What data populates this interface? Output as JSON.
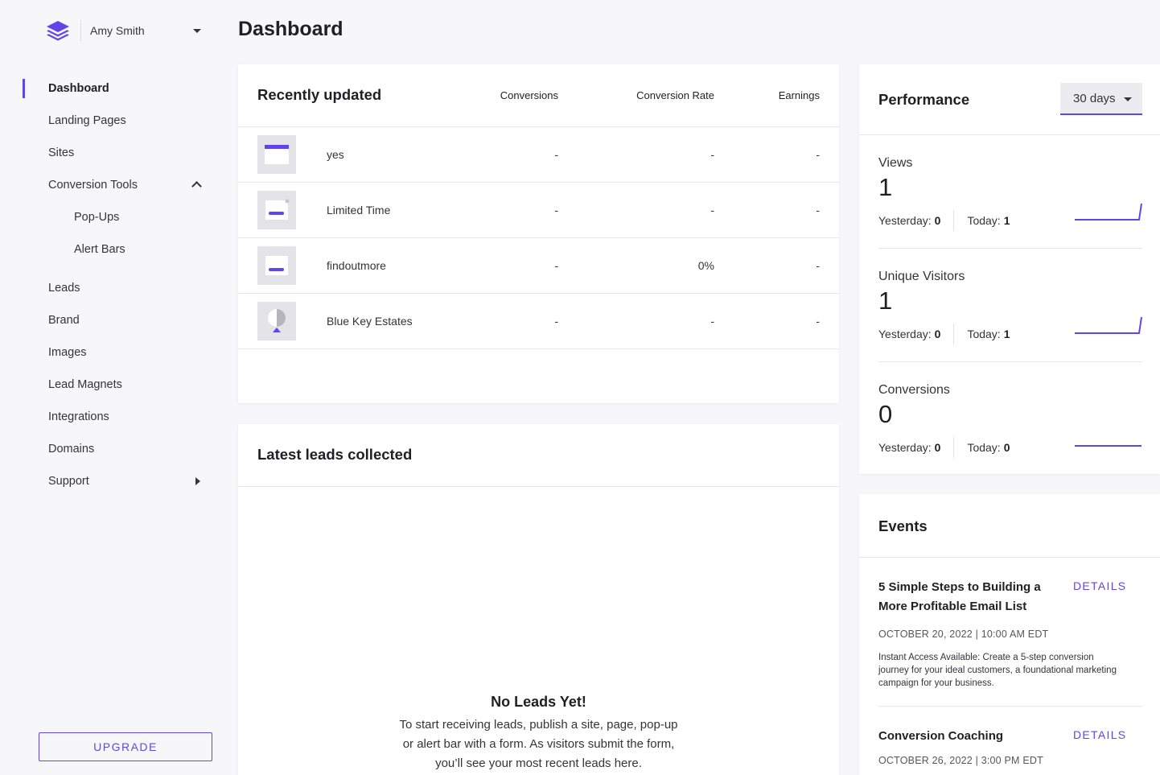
{
  "app": {
    "user_name": "Amy Smith",
    "accent_color": "#6046e8",
    "logo_icon": "stacked-layers-icon"
  },
  "sidebar": {
    "items": [
      {
        "label": "Dashboard",
        "active": true
      },
      {
        "label": "Landing Pages"
      },
      {
        "label": "Sites"
      },
      {
        "label": "Conversion Tools",
        "expanded": true
      },
      {
        "label": "Pop-Ups",
        "sub": true
      },
      {
        "label": "Alert Bars",
        "sub": true
      },
      {
        "label": "Leads"
      },
      {
        "label": "Brand"
      },
      {
        "label": "Images"
      },
      {
        "label": "Lead Magnets"
      },
      {
        "label": "Integrations"
      },
      {
        "label": "Domains"
      },
      {
        "label": "Support"
      }
    ],
    "upgrade_label": "UPGRADE"
  },
  "page": {
    "title": "Dashboard"
  },
  "recent": {
    "title": "Recently updated",
    "columns": [
      "Conversions",
      "Conversion Rate",
      "Earnings"
    ],
    "rows": [
      {
        "name": "yes",
        "conversions": "-",
        "rate": "-",
        "earnings": "-",
        "thumb_icon": "alert-bar-thumb-icon"
      },
      {
        "name": "Limited Time",
        "conversions": "-",
        "rate": "-",
        "earnings": "-",
        "thumb_icon": "popup-thumb-icon"
      },
      {
        "name": "findoutmore",
        "conversions": "-",
        "rate": "0%",
        "earnings": "-",
        "thumb_icon": "popup-thumb-icon"
      },
      {
        "name": "Blue Key Estates",
        "conversions": "-",
        "rate": "-",
        "earnings": "-",
        "thumb_icon": "landing-page-thumb-icon"
      }
    ]
  },
  "leads": {
    "title": "Latest leads collected",
    "empty_title": "No Leads Yet!",
    "empty_text": "To start receiving leads, publish a site, page, pop-up or alert bar with a form. As visitors submit the form, you’ll see your most recent leads here."
  },
  "performance": {
    "title": "Performance",
    "range": "30 days",
    "metrics": [
      {
        "label": "Views",
        "value": "1",
        "yesterday_label": "Yesterday:",
        "yesterday": "0",
        "today_label": "Today:",
        "today": "1"
      },
      {
        "label": "Unique Visitors",
        "value": "1",
        "yesterday_label": "Yesterday:",
        "yesterday": "0",
        "today_label": "Today:",
        "today": "1"
      },
      {
        "label": "Conversions",
        "value": "0",
        "yesterday_label": "Yesterday:",
        "yesterday": "0",
        "today_label": "Today:",
        "today": "0"
      }
    ]
  },
  "events": {
    "title": "Events",
    "items": [
      {
        "title": "5 Simple Steps to Building a More Profitable Email List",
        "link": "DETAILS",
        "date": "OCTOBER 20, 2022 | 10:00 AM EDT",
        "description": "Instant Access Available: Create a 5-step conversion journey for your ideal customers, a foundational marketing campaign for your business."
      },
      {
        "title": "Conversion Coaching",
        "link": "DETAILS",
        "date": "OCTOBER 26, 2022 | 3:00 PM EDT"
      }
    ]
  }
}
